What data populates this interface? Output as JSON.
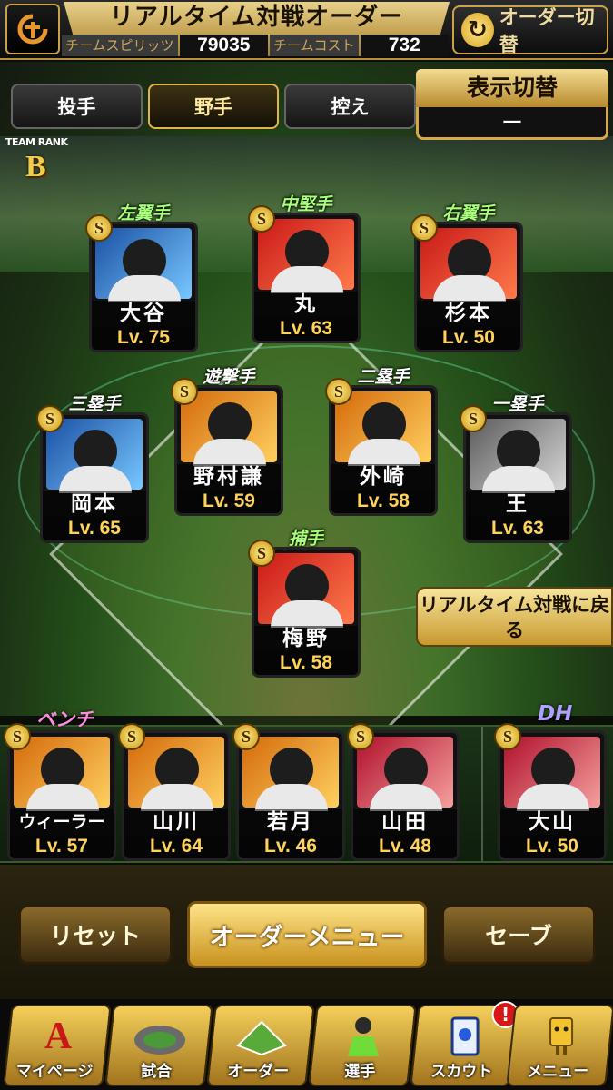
{
  "header": {
    "title": "リアルタイム対戦オーダー",
    "spirit_label": "チームスピリッツ",
    "spirit_value": "79035",
    "cost_label": "チームコスト",
    "cost_value": "732",
    "order_switch_label": "オーダー切替"
  },
  "tabs": [
    {
      "label": "投手",
      "active": false
    },
    {
      "label": "野手",
      "active": true
    },
    {
      "label": "控え",
      "active": false
    }
  ],
  "display_toggle": {
    "title": "表示切替",
    "value": "ー"
  },
  "team_rank": {
    "label": "TEAM RANK",
    "value": "B"
  },
  "lineup": [
    {
      "position": "左翼手",
      "name": "大谷",
      "level": "Lv. 75",
      "rarity": "S"
    },
    {
      "position": "中堅手",
      "name": "丸",
      "level": "Lv. 63",
      "rarity": "S"
    },
    {
      "position": "右翼手",
      "name": "杉本",
      "level": "Lv. 50",
      "rarity": "S"
    },
    {
      "position": "三塁手",
      "name": "岡本",
      "level": "Lv. 65",
      "rarity": "S"
    },
    {
      "position": "遊撃手",
      "name": "野村謙",
      "level": "Lv. 59",
      "rarity": "S"
    },
    {
      "position": "二塁手",
      "name": "外崎",
      "level": "Lv. 58",
      "rarity": "S"
    },
    {
      "position": "一塁手",
      "name": "王",
      "level": "Lv. 63",
      "rarity": "S"
    },
    {
      "position": "捕手",
      "name": "梅野",
      "level": "Lv. 58",
      "rarity": "S"
    }
  ],
  "return_button": "リアルタイム対戦に戻る",
  "bench": {
    "label": "ベンチ",
    "players": [
      {
        "name": "ウィーラー",
        "level": "Lv. 57",
        "rarity": "S"
      },
      {
        "name": "山川",
        "level": "Lv. 64",
        "rarity": "S"
      },
      {
        "name": "若月",
        "level": "Lv. 46",
        "rarity": "S"
      },
      {
        "name": "山田",
        "level": "Lv. 48",
        "rarity": "S"
      }
    ]
  },
  "dh": {
    "label": "DH",
    "name": "大山",
    "level": "Lv. 50",
    "rarity": "S"
  },
  "actions": {
    "reset": "リセット",
    "order_menu": "オーダーメニュー",
    "save": "セーブ"
  },
  "nav": [
    {
      "label": "マイページ",
      "icon": "A"
    },
    {
      "label": "試合",
      "icon": "stadium-icon"
    },
    {
      "label": "オーダー",
      "icon": "field-icon"
    },
    {
      "label": "選手",
      "icon": "player-icon"
    },
    {
      "label": "スカウト",
      "icon": "card-icon",
      "badge": "!"
    },
    {
      "label": "メニュー",
      "icon": "menu-icon"
    }
  ],
  "colors": {
    "gold": "#d7a84a",
    "level_text": "#ffd35a",
    "field_green": "#3b6b28"
  }
}
